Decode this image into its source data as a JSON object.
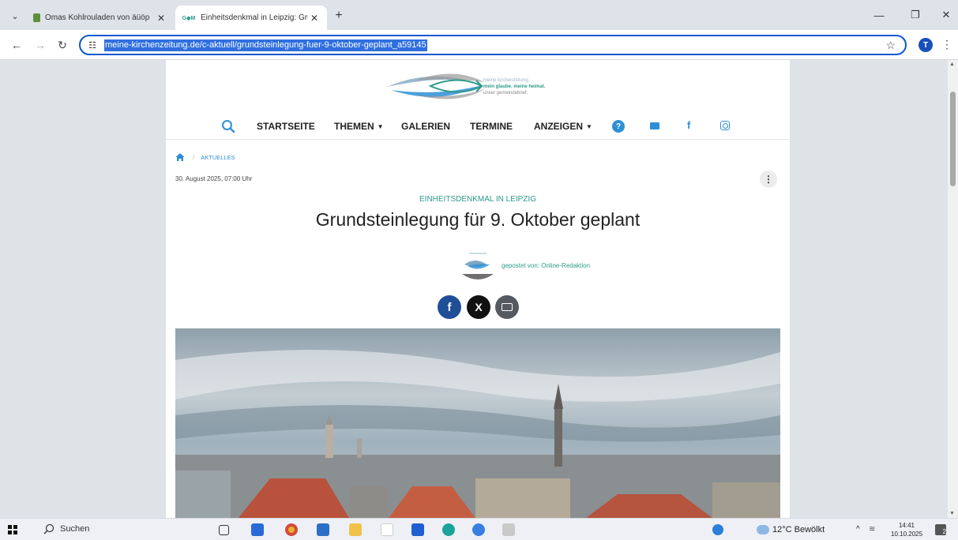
{
  "browser": {
    "tabs": [
      {
        "title": "Omas Kohlrouladen von äüöp",
        "active": false
      },
      {
        "title": "Einheitsdenkmal in Leipzig: Gru",
        "active": true
      }
    ],
    "tab_favicon_text": "G◆M",
    "new_tab_symbol": "+",
    "url": "meine-kirchenzeitung.de/c-aktuell/grundsteinlegung-fuer-9-oktober-geplant_a59145",
    "profile_initial": "T",
    "accent_color": "#0b57d0"
  },
  "site": {
    "logo": {
      "line1": "meine kirchenzeitung.",
      "line2": "mein glaube. meine heimat.",
      "line3": "unser gemeindebrief."
    },
    "nav": {
      "items": [
        "STARTSEITE",
        "THEMEN",
        "GALERIEN",
        "TERMINE",
        "ANZEIGEN"
      ],
      "help_symbol": "?",
      "facebook_symbol": "f"
    },
    "breadcrumb": {
      "section": "AKTUELLES"
    },
    "accent_color": "#2e8fd6",
    "teal_color": "#2e9a8a"
  },
  "article": {
    "datetime": "30. August 2025, 07:00 Uhr",
    "kicker": "EINHEITSDENKMAL IN LEIPZIG",
    "headline": "Grundsteinlegung für 9. Oktober geplant",
    "author": "gepostet von: Online-Redaktion",
    "share": {
      "facebook": "f",
      "x": "X"
    }
  },
  "taskbar": {
    "search_label": "Suchen",
    "weather": "12°C Bewölkt",
    "time": "14:41",
    "date": "10.10.2025",
    "notification_count": "2"
  }
}
